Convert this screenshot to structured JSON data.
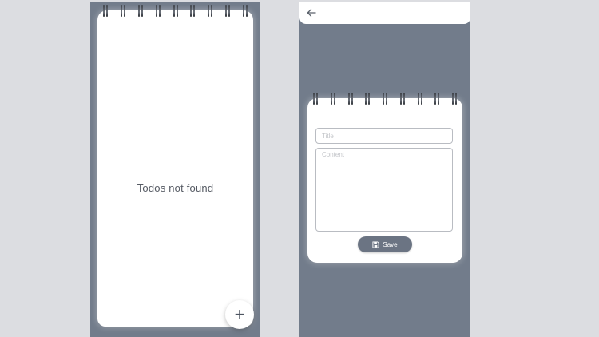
{
  "list_screen": {
    "empty_message": "Todos not found",
    "add_button_label": "+",
    "spiral_count": 9
  },
  "form_screen": {
    "back_icon": "arrow-left-icon",
    "title_placeholder": "Title",
    "title_value": "",
    "content_placeholder": "Content",
    "content_value": "",
    "save_label": "Save",
    "save_icon": "floppy-disk-icon",
    "spiral_count": 9
  },
  "colors": {
    "screen_background": "#727c8b",
    "page_background": "#dcdde1",
    "card": "#ffffff",
    "accent_button": "#6b7483"
  }
}
